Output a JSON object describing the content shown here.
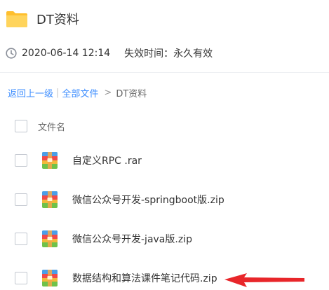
{
  "folder": {
    "name": "DT资料",
    "date": "2020-06-14 12:14",
    "expiry_label": "失效时间：",
    "expiry_value": "永久有效"
  },
  "breadcrumb": {
    "back": "返回上一级",
    "separator": "|",
    "all_files": "全部文件",
    "arrow": ">",
    "current": "DT资料"
  },
  "list": {
    "column_name": "文件名",
    "files": [
      {
        "name": "自定义RPC .rar",
        "icon": "archive-icon"
      },
      {
        "name": "微信公众号开发-springboot版.zip",
        "icon": "archive-icon"
      },
      {
        "name": "微信公众号开发-java版.zip",
        "icon": "archive-icon"
      },
      {
        "name": "数据结构和算法课件笔记代码.zip",
        "icon": "archive-icon"
      }
    ]
  },
  "colors": {
    "folder": "#ffc94a",
    "link": "#3b8cff",
    "arrow": "#e8262a"
  }
}
